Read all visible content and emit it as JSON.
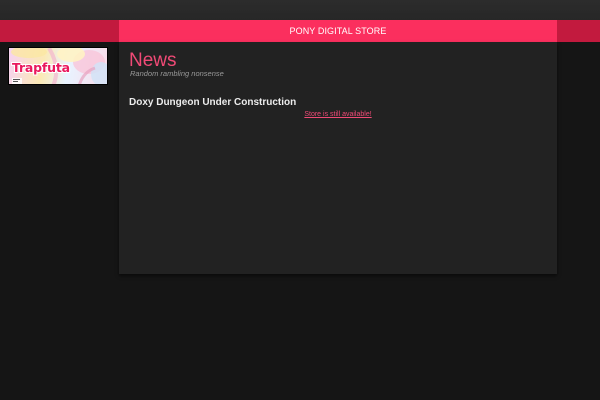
{
  "nav": {
    "store_link": "PONY DIGITAL STORE"
  },
  "banner": {
    "text": "Trapfuta"
  },
  "page": {
    "title": "News",
    "subtitle": "Random rambling nonsense"
  },
  "post": {
    "title": "Doxy Dungeon Under Construction",
    "link_text": "Store is still available!"
  },
  "colors": {
    "accent": "#fb2f5e",
    "accent_dark": "#c21a3e",
    "title_pink": "#f04a76",
    "background": "#151515",
    "panel": "#222222"
  }
}
